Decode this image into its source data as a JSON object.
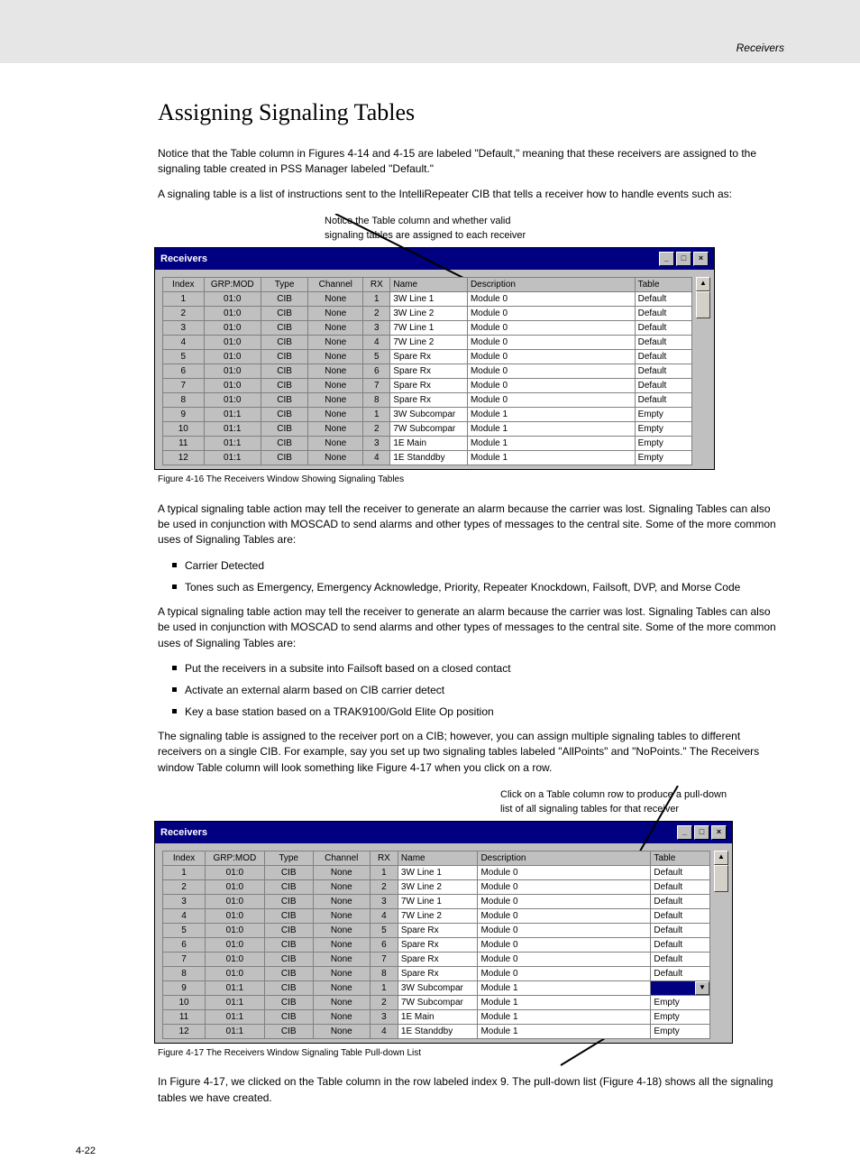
{
  "header_right": "Receivers",
  "page_number": "4-22",
  "caption1": "Figure 4-16 The Receivers Window Showing Signaling Tables",
  "caption2": "Figure 4-17 The Receivers Window Signaling Table Pull-down List",
  "h1": "Assigning Signaling Tables",
  "p1": "Notice that the Table column in Figures 4-14 and 4-15 are labeled \"Default,\" meaning that these receivers are assigned to the signaling table created in PSS Manager labeled \"Default.\"",
  "p2": "A signaling table is a list of instructions sent to the IntelliRepeater CIB that tells a receiver how to handle events such as:",
  "ul1": [
    "Carrier Detected",
    "Tones such as Emergency, Emergency Acknowledge, Priority, Repeater Knockdown, Failsoft, DVP, and Morse Code"
  ],
  "p3": "A typical signaling table action may tell the receiver to generate an alarm because the carrier was lost. Signaling Tables can also be used in conjunction with MOSCAD to send alarms and other types of messages to the central site. Some of the more common uses of Signaling Tables are:",
  "ul2": [
    "Put the receivers in a subsite into Failsoft based on a closed contact",
    "Activate an external alarm based on CIB carrier detect",
    "Key a base station based on a TRAK9100/Gold Elite Op position"
  ],
  "p4": "The signaling table is assigned to the receiver port on a CIB; however, you can assign multiple signaling tables to different receivers on a single CIB. For example, say you set up two signaling tables labeled \"AllPoints\" and \"NoPoints.\" The Receivers window Table column will look something like Figure 4-17 when you click on a row.",
  "p5": "Click on a Table column row to produce a pull-down list of all signaling tables for that receiver",
  "p6": "In Figure 4-17, we clicked on the Table column in the row labeled index 9. The pull-down list (Figure 4-18) shows all the signaling tables we have created.",
  "win_title": "Receivers",
  "win_buttons": {
    "min": "_",
    "max": "□",
    "close": "×"
  },
  "grid_headers": [
    "Index",
    "GRP:MOD",
    "Type",
    "Channel",
    "RX",
    "Name",
    "Description",
    "Table"
  ],
  "grid1_rows": [
    {
      "idx": "1",
      "gm": "01:0",
      "type": "CIB",
      "ch": "None",
      "rx": "1",
      "name": "3W Line 1",
      "desc": "Module 0",
      "tbl": "Default"
    },
    {
      "idx": "2",
      "gm": "01:0",
      "type": "CIB",
      "ch": "None",
      "rx": "2",
      "name": "3W Line 2",
      "desc": "Module 0",
      "tbl": "Default"
    },
    {
      "idx": "3",
      "gm": "01:0",
      "type": "CIB",
      "ch": "None",
      "rx": "3",
      "name": "7W Line 1",
      "desc": "Module 0",
      "tbl": "Default"
    },
    {
      "idx": "4",
      "gm": "01:0",
      "type": "CIB",
      "ch": "None",
      "rx": "4",
      "name": "7W Line 2",
      "desc": "Module 0",
      "tbl": "Default"
    },
    {
      "idx": "5",
      "gm": "01:0",
      "type": "CIB",
      "ch": "None",
      "rx": "5",
      "name": "Spare Rx",
      "desc": "Module 0",
      "tbl": "Default"
    },
    {
      "idx": "6",
      "gm": "01:0",
      "type": "CIB",
      "ch": "None",
      "rx": "6",
      "name": "Spare Rx",
      "desc": "Module 0",
      "tbl": "Default"
    },
    {
      "idx": "7",
      "gm": "01:0",
      "type": "CIB",
      "ch": "None",
      "rx": "7",
      "name": "Spare Rx",
      "desc": "Module 0",
      "tbl": "Default"
    },
    {
      "idx": "8",
      "gm": "01:0",
      "type": "CIB",
      "ch": "None",
      "rx": "8",
      "name": "Spare Rx",
      "desc": "Module 0",
      "tbl": "Default"
    },
    {
      "idx": "9",
      "gm": "01:1",
      "type": "CIB",
      "ch": "None",
      "rx": "1",
      "name": "3W Subcompar",
      "desc": "Module 1",
      "tbl": "Empty"
    },
    {
      "idx": "10",
      "gm": "01:1",
      "type": "CIB",
      "ch": "None",
      "rx": "2",
      "name": "7W Subcompar",
      "desc": "Module 1",
      "tbl": "Empty"
    },
    {
      "idx": "11",
      "gm": "01:1",
      "type": "CIB",
      "ch": "None",
      "rx": "3",
      "name": "1E Main",
      "desc": "Module 1",
      "tbl": "Empty"
    },
    {
      "idx": "12",
      "gm": "01:1",
      "type": "CIB",
      "ch": "None",
      "rx": "4",
      "name": "1E Standdby",
      "desc": "Module 1",
      "tbl": "Empty"
    }
  ],
  "grid2_rows": [
    {
      "idx": "1",
      "gm": "01:0",
      "type": "CIB",
      "ch": "None",
      "rx": "1",
      "name": "3W Line 1",
      "desc": "Module 0",
      "tbl": "Default"
    },
    {
      "idx": "2",
      "gm": "01:0",
      "type": "CIB",
      "ch": "None",
      "rx": "2",
      "name": "3W Line 2",
      "desc": "Module 0",
      "tbl": "Default"
    },
    {
      "idx": "3",
      "gm": "01:0",
      "type": "CIB",
      "ch": "None",
      "rx": "3",
      "name": "7W Line 1",
      "desc": "Module 0",
      "tbl": "Default"
    },
    {
      "idx": "4",
      "gm": "01:0",
      "type": "CIB",
      "ch": "None",
      "rx": "4",
      "name": "7W Line 2",
      "desc": "Module 0",
      "tbl": "Default"
    },
    {
      "idx": "5",
      "gm": "01:0",
      "type": "CIB",
      "ch": "None",
      "rx": "5",
      "name": "Spare Rx",
      "desc": "Module 0",
      "tbl": "Default"
    },
    {
      "idx": "6",
      "gm": "01:0",
      "type": "CIB",
      "ch": "None",
      "rx": "6",
      "name": "Spare Rx",
      "desc": "Module 0",
      "tbl": "Default"
    },
    {
      "idx": "7",
      "gm": "01:0",
      "type": "CIB",
      "ch": "None",
      "rx": "7",
      "name": "Spare Rx",
      "desc": "Module 0",
      "tbl": "Default"
    },
    {
      "idx": "8",
      "gm": "01:0",
      "type": "CIB",
      "ch": "None",
      "rx": "8",
      "name": "Spare Rx",
      "desc": "Module 0",
      "tbl": "Default"
    },
    {
      "idx": "9",
      "gm": "01:1",
      "type": "CIB",
      "ch": "None",
      "rx": "1",
      "name": "3W Subcompar",
      "desc": "Module 1",
      "tbl": "__DROPDOWN__"
    },
    {
      "idx": "10",
      "gm": "01:1",
      "type": "CIB",
      "ch": "None",
      "rx": "2",
      "name": "7W Subcompar",
      "desc": "Module 1",
      "tbl": "Empty"
    },
    {
      "idx": "11",
      "gm": "01:1",
      "type": "CIB",
      "ch": "None",
      "rx": "3",
      "name": "1E Main",
      "desc": "Module 1",
      "tbl": "Empty"
    },
    {
      "idx": "12",
      "gm": "01:1",
      "type": "CIB",
      "ch": "None",
      "rx": "4",
      "name": "1E Standdby",
      "desc": "Module 1",
      "tbl": "Empty"
    }
  ],
  "dropdown_arrow": "▼",
  "annotation1": "Notice the Table column and whether valid signaling tables are assigned to each receiver",
  "scroll_up": "▲"
}
